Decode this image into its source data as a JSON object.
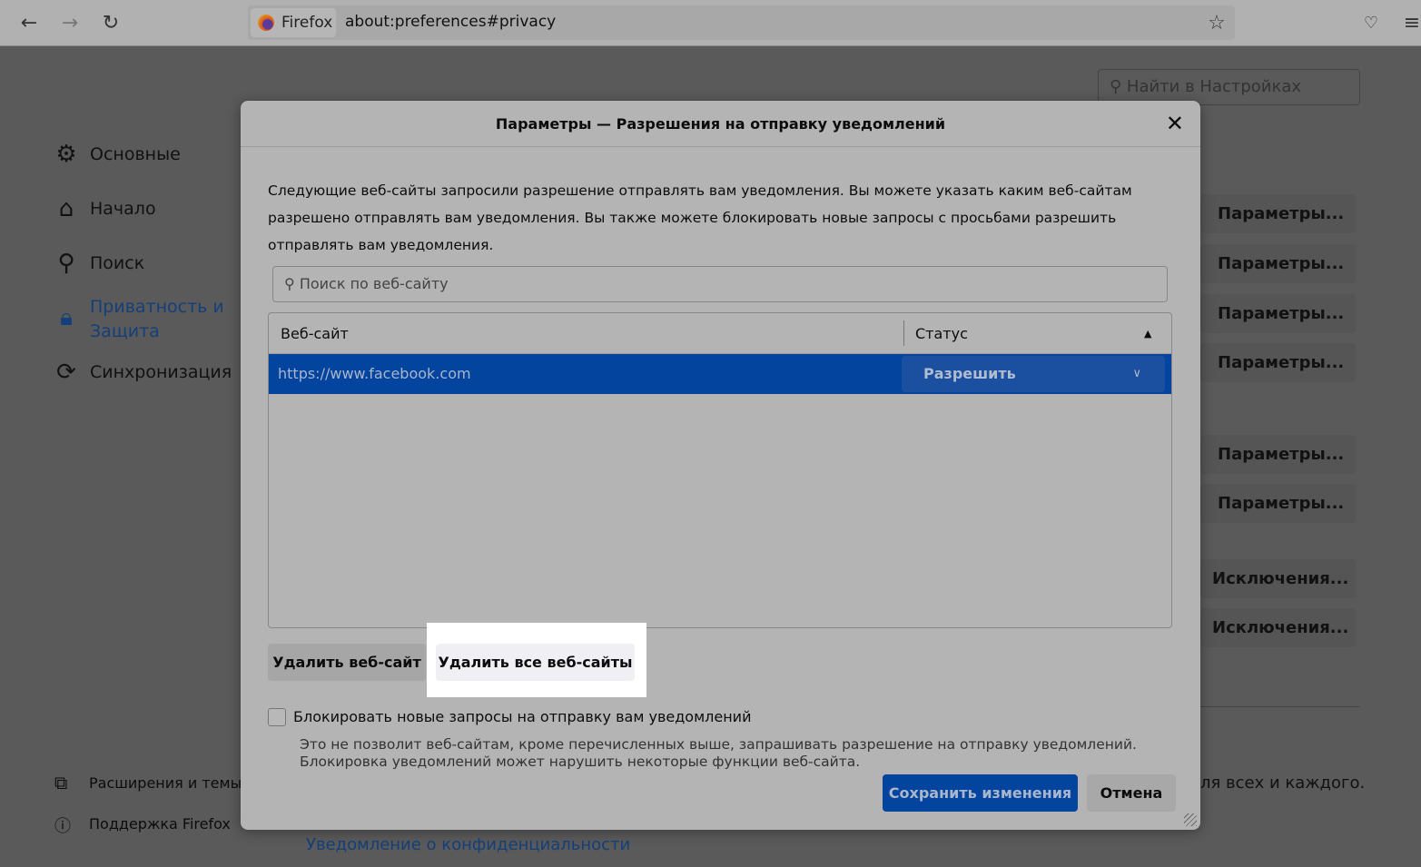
{
  "browser": {
    "identity": "Firefox",
    "url": "about:preferences#privacy"
  },
  "sidebar": {
    "items": [
      {
        "label": "Основные",
        "icon": "gear-icon"
      },
      {
        "label": "Начало",
        "icon": "home-icon"
      },
      {
        "label": "Поиск",
        "icon": "search-icon"
      },
      {
        "label": "Приватность и",
        "label2": "Защита",
        "icon": "lock-icon",
        "active": true
      },
      {
        "label": "Синхронизация",
        "icon": "sync-icon"
      }
    ],
    "footer": [
      {
        "label": "Расширения и темы"
      },
      {
        "label": "Поддержка Firefox"
      }
    ]
  },
  "page": {
    "search_placeholder": "Найти в Настройках",
    "buttons": [
      "Параметры...",
      "Параметры...",
      "Параметры...",
      "Параметры...",
      "Параметры...",
      "Параметры...",
      "Исключения...",
      "Исключения..."
    ],
    "partial_text": "ля всех и каждого.",
    "privacy_link": "Уведомление о конфиденциальности"
  },
  "dialog": {
    "title": "Параметры — Разрешения на отправку уведомлений",
    "description": "Следующие веб-сайты запросили разрешение отправлять вам уведомления. Вы можете указать каким веб-сайтам разрешено отправлять вам уведомления. Вы также можете блокировать новые запросы с просьбами разрешить отправлять вам уведомления.",
    "search_placeholder": "Поиск по веб-сайту",
    "columns": [
      "Веб-сайт",
      "Статус"
    ],
    "rows": [
      {
        "site": "https://www.facebook.com",
        "status": "Разрешить"
      }
    ],
    "remove_site": "Удалить веб-сайт",
    "remove_all": "Удалить все веб-сайты",
    "block_checkbox": "Блокировать новые запросы на отправку вам уведомлений",
    "block_checked": false,
    "note": "Это не позволит веб-сайтам, кроме перечисленных выше, запрашивать разрешение на отправку уведомлений. Блокировка уведомлений может нарушить некоторые функции веб-сайта.",
    "save": "Сохранить изменения",
    "cancel": "Отмена"
  },
  "colors": {
    "accent": "#02449e",
    "overlay": "#5a5a5a"
  }
}
